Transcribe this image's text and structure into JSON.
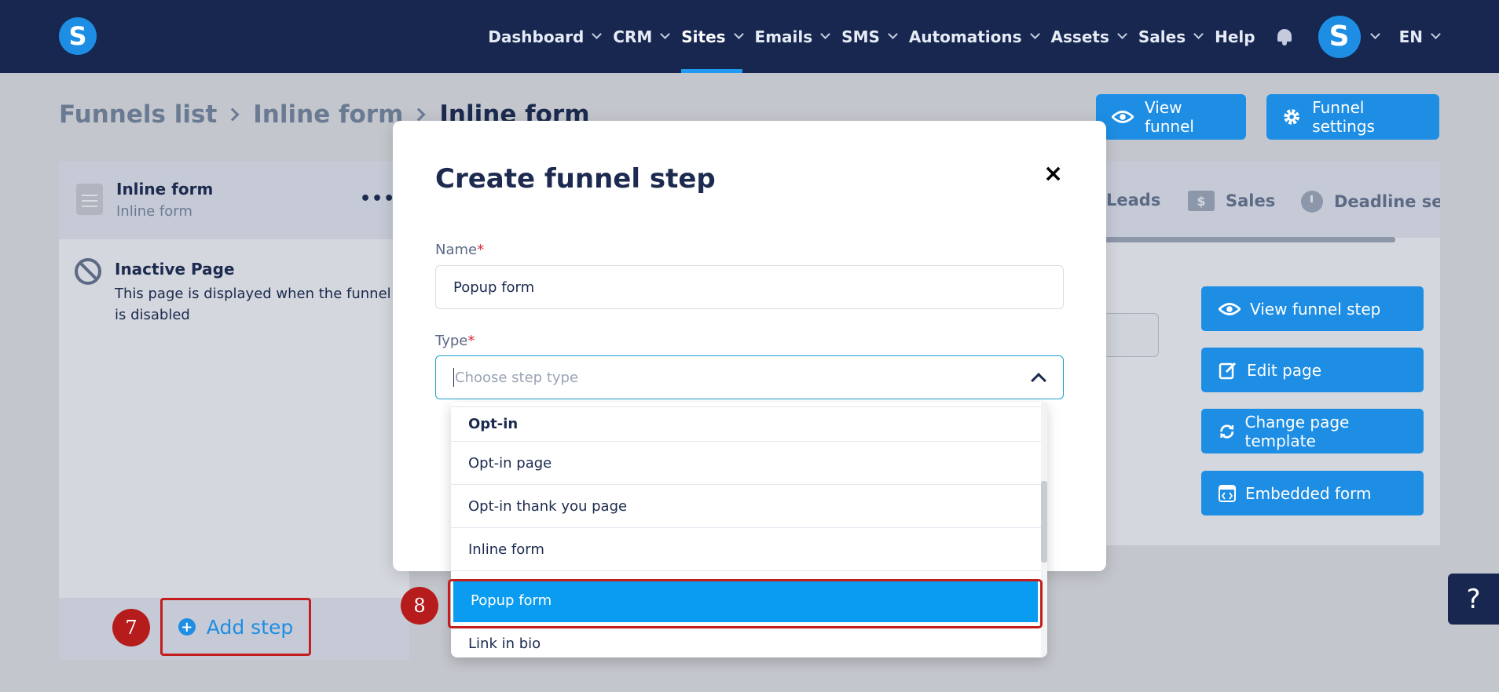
{
  "navbar": {
    "logo": "S",
    "items": [
      {
        "label": "Dashboard",
        "has_chevron": true,
        "active": false
      },
      {
        "label": "CRM",
        "has_chevron": true,
        "active": false
      },
      {
        "label": "Sites",
        "has_chevron": true,
        "active": true
      },
      {
        "label": "Emails",
        "has_chevron": true,
        "active": false
      },
      {
        "label": "SMS",
        "has_chevron": true,
        "active": false
      },
      {
        "label": "Automations",
        "has_chevron": true,
        "active": false
      },
      {
        "label": "Assets",
        "has_chevron": true,
        "active": false
      },
      {
        "label": "Sales",
        "has_chevron": true,
        "active": false
      },
      {
        "label": "Help",
        "has_chevron": false,
        "active": false
      }
    ],
    "avatar": "S",
    "language": "EN"
  },
  "breadcrumb": {
    "items": [
      "Funnels list",
      "Inline form",
      "Inline form"
    ]
  },
  "header_buttons": {
    "view_funnel": "View funnel",
    "funnel_settings": "Funnel settings"
  },
  "left_panel": {
    "step_title": "Inline form",
    "step_subtitle": "Inline form",
    "more": "•••",
    "inactive_title": "Inactive Page",
    "inactive_desc": "This page is displayed when the funnel is disabled",
    "add_step": "Add step"
  },
  "annotations": {
    "badge_7": "7",
    "badge_8": "8"
  },
  "right_panel": {
    "tabs": [
      "Leads",
      "Sales",
      "Deadline setti"
    ],
    "tab_dollar": "$",
    "buttons": {
      "view_funnel_step": "View funnel step",
      "edit_page": "Edit page",
      "change_page_template": "Change page template",
      "embedded_form": "Embedded form"
    }
  },
  "help_button": "?",
  "modal": {
    "title": "Create funnel step",
    "close": "×",
    "name_label": "Name",
    "name_value": "Popup form",
    "type_label": "Type",
    "type_placeholder": "Choose step type",
    "required_mark": "*"
  },
  "dropdown": {
    "group": "Opt-in",
    "options": [
      "Opt-in page",
      "Opt-in thank you page",
      "Inline form",
      "Popup form",
      "Link in bio"
    ],
    "selected": "Popup form"
  },
  "colors": {
    "navbar_bg": "#172750",
    "accent": "#1e8ee4",
    "selected_option": "#0a9cf0",
    "annotation_red": "#c31d1d"
  }
}
